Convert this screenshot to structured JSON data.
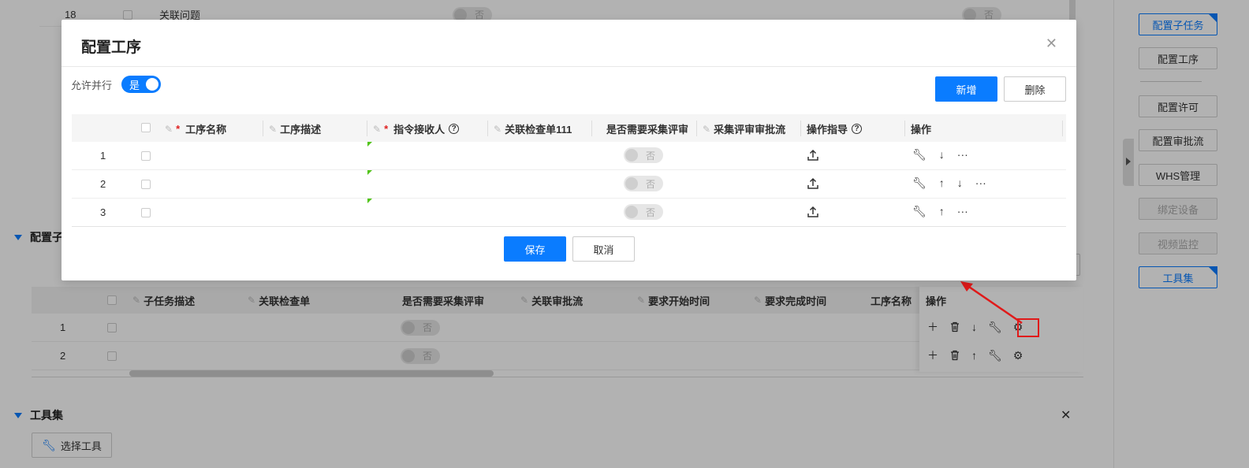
{
  "background": {
    "row18": {
      "index": "18",
      "label": "关联问题",
      "switch1": "否",
      "switch2": "否"
    },
    "section_subtask": {
      "title": "配置子"
    },
    "subtask_table": {
      "columns": [
        "子任务描述",
        "关联检查单",
        "是否需要采集评审",
        "关联审批流",
        "要求开始时间",
        "要求完成时间",
        "工序名称",
        "操作"
      ],
      "rows": [
        {
          "index": "1",
          "switch": "否"
        },
        {
          "index": "2",
          "switch": "否"
        }
      ]
    },
    "section_tools": {
      "title": "工具集",
      "select_button": "选择工具"
    }
  },
  "sidebar": {
    "buttons": [
      {
        "label": "配置子任务",
        "state": "active"
      },
      {
        "label": "配置工序",
        "state": "normal"
      },
      {
        "label": "配置许可",
        "state": "normal"
      },
      {
        "label": "配置审批流",
        "state": "normal"
      },
      {
        "label": "WHS管理",
        "state": "normal"
      },
      {
        "label": "绑定设备",
        "state": "disabled"
      },
      {
        "label": "视频监控",
        "state": "disabled"
      },
      {
        "label": "工具集",
        "state": "active"
      }
    ]
  },
  "modal": {
    "title": "配置工序",
    "allow_parallel_label": "允许并行",
    "allow_parallel_value": "是",
    "add_button": "新增",
    "delete_button": "删除",
    "columns": [
      "工序名称",
      "工序描述",
      "指令接收人",
      "关联检查单111",
      "是否需要采集评审",
      "采集评审审批流",
      "操作指导",
      "操作"
    ],
    "rows": [
      {
        "index": "1",
        "switch": "否"
      },
      {
        "index": "2",
        "switch": "否"
      },
      {
        "index": "3",
        "switch": "否"
      }
    ],
    "save_button": "保存",
    "cancel_button": "取消"
  },
  "icons": {
    "close": "close-icon",
    "pencil": "pencil-icon",
    "help": "question-icon",
    "upload": "upload-icon",
    "wrench": "wrench-icon",
    "arrow_up": "arrow-up-icon",
    "arrow_down": "arrow-down-icon",
    "more": "more-icon",
    "plus": "plus-icon",
    "trash": "trash-icon",
    "gear": "gear-icon"
  },
  "colors": {
    "primary": "#0a7cff",
    "highlight": "#e01a1a",
    "required": "#e02020"
  }
}
